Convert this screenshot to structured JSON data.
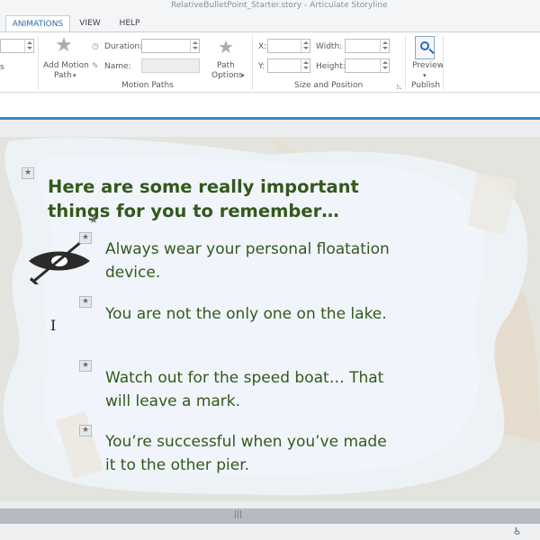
{
  "window": {
    "title": "RelativeBulletPoint_Starter.story - Articulate Storyline"
  },
  "tabs": [
    {
      "label": "ANIMATIONS",
      "active": true
    },
    {
      "label": "VIEW",
      "active": false
    },
    {
      "label": "HELP",
      "active": false
    }
  ],
  "ribbon": {
    "partial_left_label": "s",
    "add_motion_path": {
      "line1": "Add Motion",
      "line2": "Path"
    },
    "duration_label": "Duration:",
    "name_label": "Name:",
    "path_options": {
      "line1": "Path",
      "line2": "Options"
    },
    "motion_paths_group": "Motion Paths",
    "x_label": "X:",
    "y_label": "Y:",
    "width_label": "Width:",
    "height_label": "Height:",
    "size_position_group": "Size and Position",
    "preview_label": "Preview",
    "publish_group": "Publish"
  },
  "slide": {
    "heading": "Here are some really important things for you to remember…",
    "bullets": [
      "Always wear your personal floatation device.",
      "You are not the only one on the lake.",
      "Watch out for the speed boat… That will leave a mark.",
      "You’re successful when you’ve made it to the other pier."
    ],
    "colors": {
      "text": "#33591c",
      "ribbon_accent": "#3f84c7"
    }
  },
  "icons": {
    "star": "★",
    "cursor": "I",
    "grip": "|||",
    "accessibility": "♿"
  }
}
